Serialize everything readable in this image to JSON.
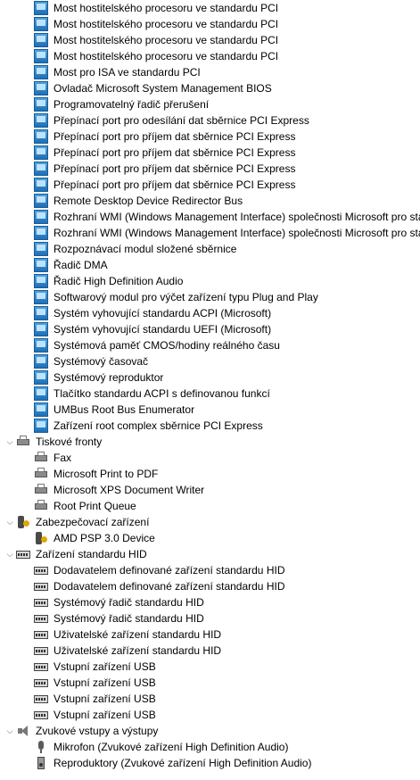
{
  "window_title": "",
  "system_devices": [
    "Most hostitelského procesoru ve standardu PCI",
    "Most hostitelského procesoru ve standardu PCI",
    "Most hostitelského procesoru ve standardu PCI",
    "Most hostitelského procesoru ve standardu PCI",
    "Most pro ISA ve standardu PCI",
    "Ovladač Microsoft System Management BIOS",
    "Programovatelný řadič přerušení",
    "Přepínací port pro odesílání dat sběrnice PCI Express",
    "Přepínací port pro příjem dat sběrnice PCI Express",
    "Přepínací port pro příjem dat sběrnice PCI Express",
    "Přepínací port pro příjem dat sběrnice PCI Express",
    "Přepínací port pro příjem dat sběrnice PCI Express",
    "Remote Desktop Device Redirector Bus",
    "Rozhraní WMI (Windows Management Interface) společnosti Microsoft pro sta",
    "Rozhraní WMI (Windows Management Interface) společnosti Microsoft pro sta",
    "Rozpoznávací modul složené sběrnice",
    "Řadič DMA",
    "Řadič High Definition Audio",
    "Softwarový modul pro výčet zařízení typu Plug and Play",
    "Systém vyhovující standardu ACPI (Microsoft)",
    "Systém vyhovující standardu UEFI (Microsoft)",
    "Systémová paměť CMOS/hodiny reálného času",
    "Systémový časovač",
    "Systémový reproduktor",
    "Tlačítko standardu ACPI s definovanou funkcí",
    "UMBus Root Bus Enumerator",
    "Zařízení root complex sběrnice PCI Express"
  ],
  "groups": {
    "print_queues": {
      "label": "Tiskové fronty",
      "items": [
        "Fax",
        "Microsoft Print to PDF",
        "Microsoft XPS Document Writer",
        "Root Print Queue"
      ]
    },
    "security": {
      "label": "Zabezpečovací zařízení",
      "items": [
        "AMD PSP 3.0 Device"
      ]
    },
    "hid": {
      "label": "Zařízení standardu HID",
      "items": [
        "Dodavatelem definované zařízení standardu HID",
        "Dodavatelem definované zařízení standardu HID",
        "Systémový řadič standardu HID",
        "Systémový řadič standardu HID",
        "Uživatelské zařízení standardu HID",
        "Uživatelské zařízení standardu HID",
        "Vstupní zařízení USB",
        "Vstupní zařízení USB",
        "Vstupní zařízení USB",
        "Vstupní zařízení USB"
      ]
    },
    "audio": {
      "label": "Zvukové vstupy a výstupy",
      "items": [
        "Mikrofon (Zvukové zařízení High Definition Audio)",
        "Reproduktory (Zvukové zařízení High Definition Audio)"
      ]
    }
  },
  "icons": {
    "system": "system-device-icon",
    "printer": "printer-icon",
    "security": "security-device-icon",
    "hid": "hid-device-icon",
    "audio": "speaker-icon",
    "microphone": "microphone-icon"
  }
}
